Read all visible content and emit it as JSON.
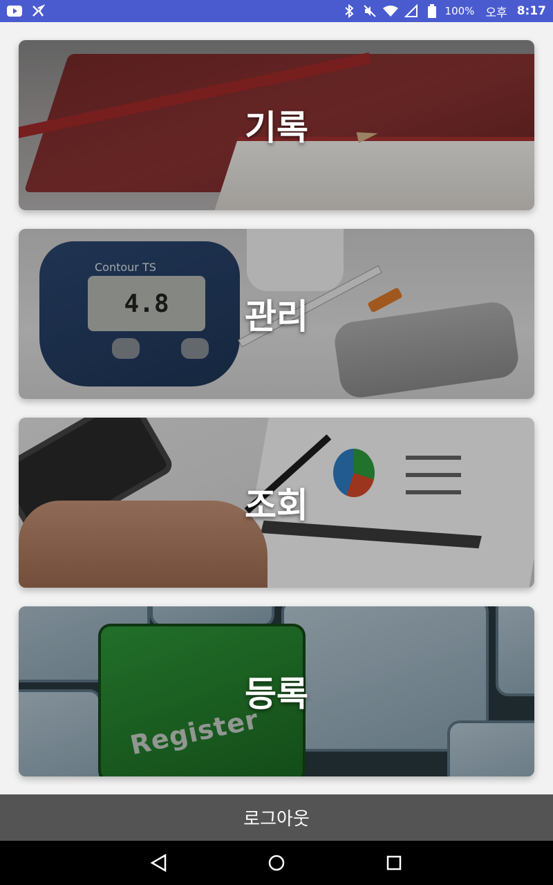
{
  "status_bar": {
    "battery": "100%",
    "ampm": "오후",
    "time": "8:17",
    "icons": [
      "youtube-icon",
      "app-icon",
      "bluetooth-icon",
      "mute-icon",
      "wifi-icon",
      "signal-icon",
      "battery-icon"
    ]
  },
  "menu": {
    "record_label": "기록",
    "manage_label": "관리",
    "view_label": "조회",
    "register_label": "등록",
    "register_key_text": "Register",
    "meter_brand": "Contour TS",
    "meter_reading": "4.8"
  },
  "footer": {
    "logout_label": "로그아웃"
  },
  "nav": {
    "icons": [
      "back-icon",
      "home-icon",
      "recents-icon"
    ]
  }
}
